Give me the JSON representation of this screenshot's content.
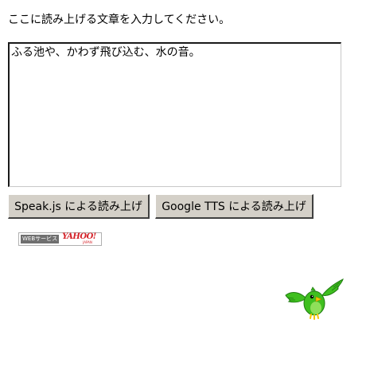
{
  "instruction": "ここに読み上げる文章を入力してください。",
  "textarea": {
    "value": "ふる池や、かわず飛び込む、水の音。"
  },
  "buttons": {
    "speakjs": "Speak.js による読み上げ",
    "google_tts": "Google TTS による読み上げ"
  },
  "credit": {
    "left_text": "WEBサービス",
    "logo_text": "YAHOO!",
    "sub_text": "JAPAN"
  },
  "mascot": {
    "icon": "green-bird-icon",
    "body_color": "#3fbf1f",
    "accent_color": "#f5c400"
  }
}
